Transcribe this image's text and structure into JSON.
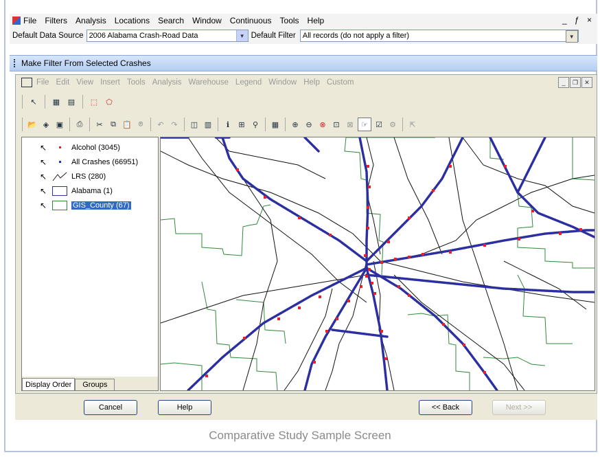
{
  "menu": [
    "File",
    "Filters",
    "Analysis",
    "Locations",
    "Search",
    "Window",
    "Continuous",
    "Tools",
    "Help"
  ],
  "menu_underline": [
    "F",
    "F",
    "A",
    "L",
    "S",
    "W",
    "C",
    "T",
    "H"
  ],
  "window_controls": "_ ƒ ×",
  "source": {
    "label": "Default Data Source",
    "value": "2006 Alabama Crash-Road Data",
    "filter_label": "Default Filter",
    "filter_value": "All records (do not apply a filter)"
  },
  "band": {
    "title": "Make Filter From Selected Crashes"
  },
  "gis_menu": [
    "File",
    "Edit",
    "View",
    "Insert",
    "Tools",
    "Analysis",
    "Warehouse",
    "Legend",
    "Window",
    "Help",
    "Custom"
  ],
  "layers": [
    {
      "label": "Alcohol (3045)",
      "symbol": "red-dot"
    },
    {
      "label": "All Crashes (66951)",
      "symbol": "blue-dot"
    },
    {
      "label": "LRS (280)",
      "symbol": "line"
    },
    {
      "label": "Alabama (1)",
      "symbol": "box-blue"
    },
    {
      "label": "GIS_County (67)",
      "symbol": "box-green"
    }
  ],
  "tabs": [
    "Display Order",
    "Groups"
  ],
  "buttons": {
    "cancel": "Cancel",
    "help": "Help",
    "back": "<< Back",
    "next": "Next >>"
  },
  "caption": "Comparative Study Sample Screen",
  "colors": {
    "highway": "#2b2fa0",
    "crash": "#e8202a",
    "county": "#2e8b3a",
    "road": "#111111",
    "band": "#c4d8f6"
  }
}
